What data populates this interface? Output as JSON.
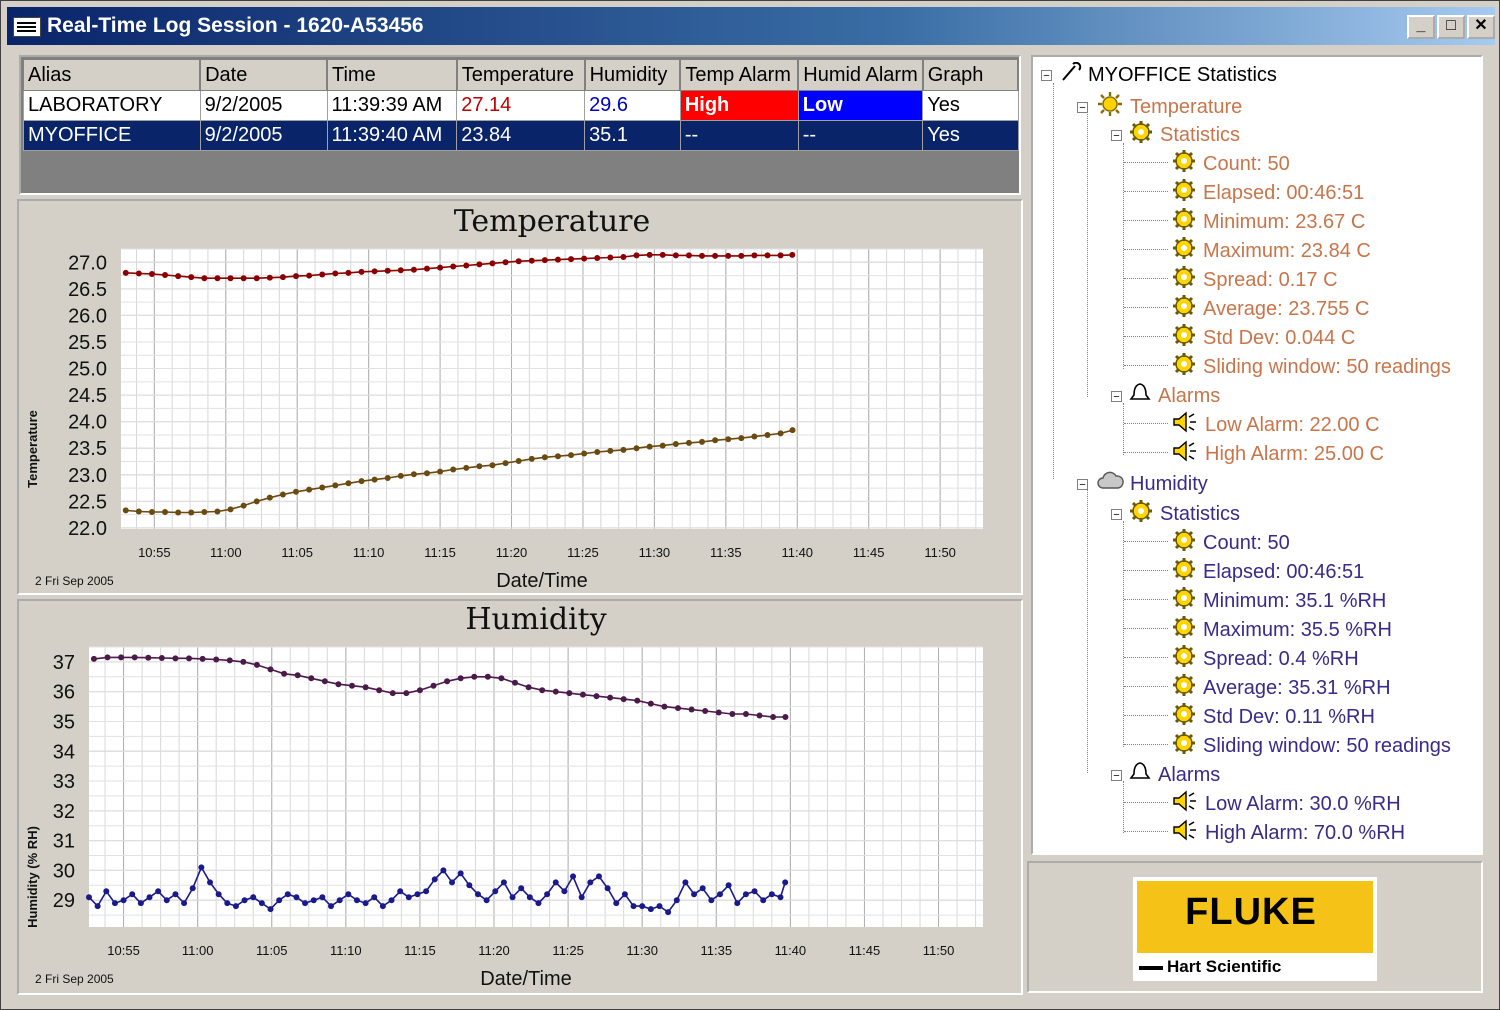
{
  "window": {
    "title": "Real-Time Log Session - 1620-A53456",
    "controls": [
      "_",
      "□",
      "✕"
    ]
  },
  "grid": {
    "columns": [
      "Alias",
      "Date",
      "Time",
      "Temperature",
      "Humidity",
      "Temp Alarm",
      "Humid Alarm",
      "Graph"
    ],
    "rows": [
      {
        "alias": "LABORATORY",
        "date": "9/2/2005",
        "time": "11:39:39 AM",
        "temperature": "27.14",
        "humidity": "29.6",
        "temp_alarm": "High",
        "humid_alarm": "Low",
        "graph": "Yes"
      },
      {
        "alias": "MYOFFICE",
        "date": "9/2/2005",
        "time": "11:39:40 AM",
        "temperature": "23.84",
        "humidity": "35.1",
        "temp_alarm": "--",
        "humid_alarm": "--",
        "graph": "Yes"
      }
    ]
  },
  "colors": {
    "series_red": "#8b0000",
    "series_olive": "#6b4a10",
    "series_purple": "#4b1a4b",
    "series_blue": "#1a1a8c",
    "alarm_high": "#ff0000",
    "alarm_low": "#0000ff",
    "temp_tree_text": "#c9754a",
    "humidity_tree_text": "#3a2a8a"
  },
  "tree": {
    "root": "MYOFFICE Statistics",
    "temperature": {
      "label": "Temperature",
      "statistics_label": "Statistics",
      "stats": [
        "Count: 50",
        "Elapsed: 00:46:51",
        "Minimum: 23.67 C",
        "Maximum: 23.84 C",
        "Spread: 0.17 C",
        "Average: 23.755 C",
        "Std Dev: 0.044 C",
        "Sliding window: 50 readings"
      ],
      "alarms_label": "Alarms",
      "alarms": [
        "Low Alarm: 22.00 C",
        "High Alarm: 25.00 C"
      ]
    },
    "humidity": {
      "label": "Humidity",
      "statistics_label": "Statistics",
      "stats": [
        "Count: 50",
        "Elapsed: 00:46:51",
        "Minimum: 35.1 %RH",
        "Maximum: 35.5 %RH",
        "Spread: 0.4 %RH",
        "Average: 35.31 %RH",
        "Std Dev: 0.11 %RH",
        "Sliding window: 50 readings"
      ],
      "alarms_label": "Alarms",
      "alarms": [
        "Low Alarm: 30.0 %RH",
        "High Alarm: 70.0 %RH"
      ]
    }
  },
  "logo": {
    "brand": "FLUKE",
    "sub": "Hart Scientific"
  },
  "chart_data": [
    {
      "type": "line",
      "title": "Temperature",
      "xlabel": "Date/Time",
      "ylabel": "Temperature",
      "date_label": "2 Fri Sep 2005",
      "xticks": [
        "10:55",
        "11:00",
        "11:05",
        "11:10",
        "11:15",
        "11:20",
        "11:25",
        "11:30",
        "11:35",
        "11:40",
        "11:45",
        "11:50"
      ],
      "yticks": [
        "27.0",
        "26.5",
        "26.0",
        "25.5",
        "25.0",
        "24.5",
        "24.0",
        "23.5",
        "23.0",
        "22.5",
        "22.0"
      ],
      "xlim": [
        "10:52:40",
        "11:53:00"
      ],
      "ylim": [
        21.98,
        27.25
      ],
      "grid": true,
      "series": [
        {
          "color": "#8b0000",
          "x": [
            "10:53:00",
            "10:53:55",
            "10:54:50",
            "10:55:45",
            "10:56:40",
            "10:57:35",
            "10:58:30",
            "10:59:25",
            "11:00:20",
            "11:01:15",
            "11:02:10",
            "11:03:05",
            "11:04:00",
            "11:04:55",
            "11:05:50",
            "11:06:45",
            "11:07:40",
            "11:08:35",
            "11:09:30",
            "11:10:25",
            "11:11:20",
            "11:12:15",
            "11:13:10",
            "11:14:05",
            "11:15:00",
            "11:15:55",
            "11:16:50",
            "11:17:45",
            "11:18:40",
            "11:19:35",
            "11:20:30",
            "11:21:25",
            "11:22:20",
            "11:23:15",
            "11:24:10",
            "11:25:05",
            "11:26:00",
            "11:26:55",
            "11:27:50",
            "11:28:45",
            "11:29:40",
            "11:30:35",
            "11:31:30",
            "11:32:25",
            "11:33:20",
            "11:34:15",
            "11:35:10",
            "11:36:05",
            "11:37:00",
            "11:37:55",
            "11:38:50",
            "11:39:39"
          ],
          "y": [
            26.8,
            26.79,
            26.78,
            26.76,
            26.74,
            26.72,
            26.7,
            26.7,
            26.7,
            26.7,
            26.7,
            26.71,
            26.72,
            26.74,
            26.75,
            26.77,
            26.79,
            26.8,
            26.82,
            26.83,
            26.84,
            26.85,
            26.86,
            26.88,
            26.9,
            26.92,
            26.94,
            26.96,
            26.98,
            27.0,
            27.02,
            27.03,
            27.04,
            27.05,
            27.06,
            27.07,
            27.08,
            27.09,
            27.1,
            27.13,
            27.14,
            27.14,
            27.13,
            27.13,
            27.12,
            27.12,
            27.12,
            27.12,
            27.13,
            27.13,
            27.13,
            27.14
          ]
        },
        {
          "color": "#6b4a10",
          "x": [
            "10:53:00",
            "10:53:55",
            "10:54:50",
            "10:55:45",
            "10:56:40",
            "10:57:35",
            "10:58:30",
            "10:59:25",
            "11:00:20",
            "11:01:15",
            "11:02:10",
            "11:03:05",
            "11:04:00",
            "11:04:55",
            "11:05:50",
            "11:06:45",
            "11:07:40",
            "11:08:35",
            "11:09:30",
            "11:10:25",
            "11:11:20",
            "11:12:15",
            "11:13:10",
            "11:14:05",
            "11:15:00",
            "11:15:55",
            "11:16:50",
            "11:17:45",
            "11:18:40",
            "11:19:35",
            "11:20:30",
            "11:21:25",
            "11:22:20",
            "11:23:15",
            "11:24:10",
            "11:25:05",
            "11:26:00",
            "11:26:55",
            "11:27:50",
            "11:28:45",
            "11:29:40",
            "11:30:35",
            "11:31:30",
            "11:32:25",
            "11:33:20",
            "11:34:15",
            "11:35:10",
            "11:36:05",
            "11:37:00",
            "11:37:55",
            "11:38:50",
            "11:39:40"
          ],
          "y": [
            22.33,
            22.31,
            22.3,
            22.3,
            22.29,
            22.29,
            22.3,
            22.31,
            22.35,
            22.42,
            22.5,
            22.57,
            22.63,
            22.68,
            22.72,
            22.76,
            22.8,
            22.84,
            22.88,
            22.91,
            22.94,
            22.98,
            23.01,
            23.03,
            23.06,
            23.1,
            23.13,
            23.16,
            23.18,
            23.22,
            23.26,
            23.3,
            23.33,
            23.35,
            23.37,
            23.4,
            23.43,
            23.45,
            23.47,
            23.5,
            23.53,
            23.55,
            23.58,
            23.6,
            23.62,
            23.65,
            23.67,
            23.69,
            23.72,
            23.75,
            23.78,
            23.84
          ]
        }
      ]
    },
    {
      "type": "line",
      "title": "Humidity",
      "xlabel": "Date/Time",
      "ylabel": "Humidity (% RH)",
      "date_label": "2 Fri Sep 2005",
      "xticks": [
        "10:55",
        "11:00",
        "11:05",
        "11:10",
        "11:15",
        "11:20",
        "11:25",
        "11:30",
        "11:35",
        "11:40",
        "11:45",
        "11:50"
      ],
      "yticks": [
        "37",
        "36",
        "35",
        "34",
        "33",
        "32",
        "31",
        "30",
        "29"
      ],
      "xlim": [
        "10:52:40",
        "11:53:00"
      ],
      "ylim": [
        28.1,
        37.5
      ],
      "grid": true,
      "series": [
        {
          "color": "#4b1a4b",
          "x": [
            "10:53:00",
            "10:53:55",
            "10:54:50",
            "10:55:45",
            "10:56:40",
            "10:57:35",
            "10:58:30",
            "10:59:25",
            "11:00:20",
            "11:01:15",
            "11:02:10",
            "11:03:05",
            "11:04:00",
            "11:04:55",
            "11:05:50",
            "11:06:45",
            "11:07:40",
            "11:08:35",
            "11:09:30",
            "11:10:25",
            "11:11:20",
            "11:12:15",
            "11:13:10",
            "11:14:05",
            "11:15:00",
            "11:15:55",
            "11:16:50",
            "11:17:45",
            "11:18:40",
            "11:19:35",
            "11:20:30",
            "11:21:25",
            "11:22:20",
            "11:23:15",
            "11:24:10",
            "11:25:05",
            "11:26:00",
            "11:26:55",
            "11:27:50",
            "11:28:45",
            "11:29:40",
            "11:30:35",
            "11:31:30",
            "11:32:25",
            "11:33:20",
            "11:34:15",
            "11:35:10",
            "11:36:05",
            "11:37:00",
            "11:37:55",
            "11:38:50",
            "11:39:40"
          ],
          "y": [
            37.1,
            37.15,
            37.15,
            37.15,
            37.14,
            37.13,
            37.12,
            37.12,
            37.1,
            37.08,
            37.05,
            37.0,
            36.9,
            36.75,
            36.6,
            36.55,
            36.45,
            36.35,
            36.25,
            36.2,
            36.15,
            36.05,
            35.95,
            35.95,
            36.05,
            36.2,
            36.35,
            36.45,
            36.5,
            36.5,
            36.45,
            36.3,
            36.15,
            36.05,
            36.0,
            35.95,
            35.9,
            35.85,
            35.8,
            35.75,
            35.7,
            35.6,
            35.5,
            35.45,
            35.4,
            35.35,
            35.3,
            35.25,
            35.25,
            35.2,
            35.15,
            35.15
          ]
        },
        {
          "color": "#1a1a8c",
          "x": [
            "10:52:40",
            "10:53:15",
            "10:53:50",
            "10:54:25",
            "10:55:00",
            "10:55:35",
            "10:56:10",
            "10:56:45",
            "10:57:20",
            "10:57:55",
            "10:58:30",
            "10:59:05",
            "10:59:40",
            "11:00:15",
            "11:00:50",
            "11:01:25",
            "11:02:00",
            "11:02:35",
            "11:03:10",
            "11:03:45",
            "11:04:20",
            "11:04:55",
            "11:05:30",
            "11:06:05",
            "11:06:40",
            "11:07:15",
            "11:07:50",
            "11:08:25",
            "11:09:00",
            "11:09:35",
            "11:10:10",
            "11:10:45",
            "11:11:20",
            "11:11:55",
            "11:12:30",
            "11:13:05",
            "11:13:40",
            "11:14:15",
            "11:14:50",
            "11:15:25",
            "11:16:00",
            "11:16:35",
            "11:17:10",
            "11:17:45",
            "11:18:20",
            "11:18:55",
            "11:19:30",
            "11:20:05",
            "11:20:40",
            "11:21:15",
            "11:21:50",
            "11:22:25",
            "11:23:00",
            "11:23:35",
            "11:24:10",
            "11:24:45",
            "11:25:20",
            "11:25:55",
            "11:26:30",
            "11:27:05",
            "11:27:40",
            "11:28:15",
            "11:28:50",
            "11:29:25",
            "11:30:00",
            "11:30:35",
            "11:31:10",
            "11:31:45",
            "11:32:20",
            "11:32:55",
            "11:33:30",
            "11:34:05",
            "11:34:40",
            "11:35:15",
            "11:35:50",
            "11:36:25",
            "11:37:00",
            "11:37:35",
            "11:38:10",
            "11:38:45",
            "11:39:20",
            "11:39:39"
          ],
          "y": [
            29.1,
            28.8,
            29.3,
            28.9,
            29.0,
            29.2,
            28.9,
            29.1,
            29.3,
            29.0,
            29.2,
            28.9,
            29.4,
            30.1,
            29.6,
            29.2,
            28.9,
            28.8,
            29.0,
            29.1,
            28.9,
            28.7,
            29.0,
            29.2,
            29.1,
            28.9,
            29.0,
            29.1,
            28.8,
            29.0,
            29.2,
            29.0,
            28.9,
            29.1,
            28.8,
            29.0,
            29.3,
            29.1,
            29.2,
            29.3,
            29.7,
            30.0,
            29.6,
            29.9,
            29.5,
            29.2,
            29.0,
            29.3,
            29.6,
            29.1,
            29.4,
            29.1,
            28.9,
            29.2,
            29.6,
            29.3,
            29.8,
            29.1,
            29.6,
            29.8,
            29.4,
            28.9,
            29.2,
            28.8,
            28.8,
            28.7,
            28.8,
            28.6,
            29.0,
            29.6,
            29.2,
            29.4,
            29.0,
            29.2,
            29.5,
            28.9,
            29.2,
            29.3,
            29.0,
            29.2,
            29.1,
            29.6
          ]
        }
      ]
    }
  ]
}
